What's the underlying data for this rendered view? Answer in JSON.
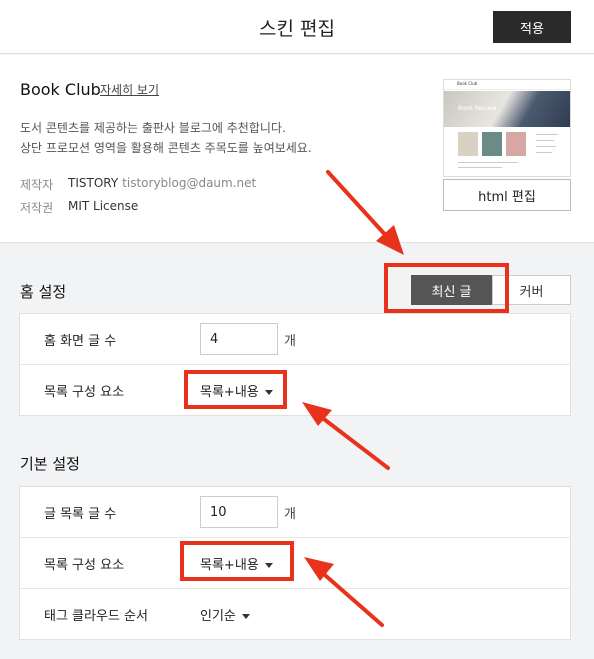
{
  "header": {
    "title": "스킨 편집",
    "apply_label": "적용"
  },
  "skin": {
    "name": "Book Club",
    "detail_link": "자세히 보기",
    "description": [
      "도서 콘텐츠를 제공하는 출판사 블로그에 추천합니다.",
      "상단 프로모션 영역을 활용해 콘텐츠 주목도를 높여보세요."
    ],
    "author_label": "제작자",
    "author_name": "TISTORY",
    "author_email": "tistoryblog@daum.net",
    "license_label": "저작권",
    "license_value": "MIT License",
    "html_edit_label": "html 편집",
    "preview": {
      "blog_title": "Book Club",
      "hero_text": "Book Review"
    }
  },
  "home_settings": {
    "title": "홈 설정",
    "tabs": [
      {
        "label": "최신 글",
        "active": true
      },
      {
        "label": "커버",
        "active": false
      }
    ],
    "post_count_label": "홈 화면 글 수",
    "post_count_value": "4",
    "post_count_unit": "개",
    "list_elements_label": "목록 구성 요소",
    "list_elements_value": "목록+내용"
  },
  "basic_settings": {
    "title": "기본 설정",
    "post_count_label": "글 목록 글 수",
    "post_count_value": "10",
    "post_count_unit": "개",
    "list_elements_label": "목록 구성 요소",
    "list_elements_value": "목록+내용",
    "tag_cloud_label": "태그 클라우드 순서",
    "tag_cloud_value": "인기순"
  },
  "colors": {
    "accent_red": "#e8321c",
    "dark_button": "#2a2a2a",
    "active_tab": "#555555"
  }
}
